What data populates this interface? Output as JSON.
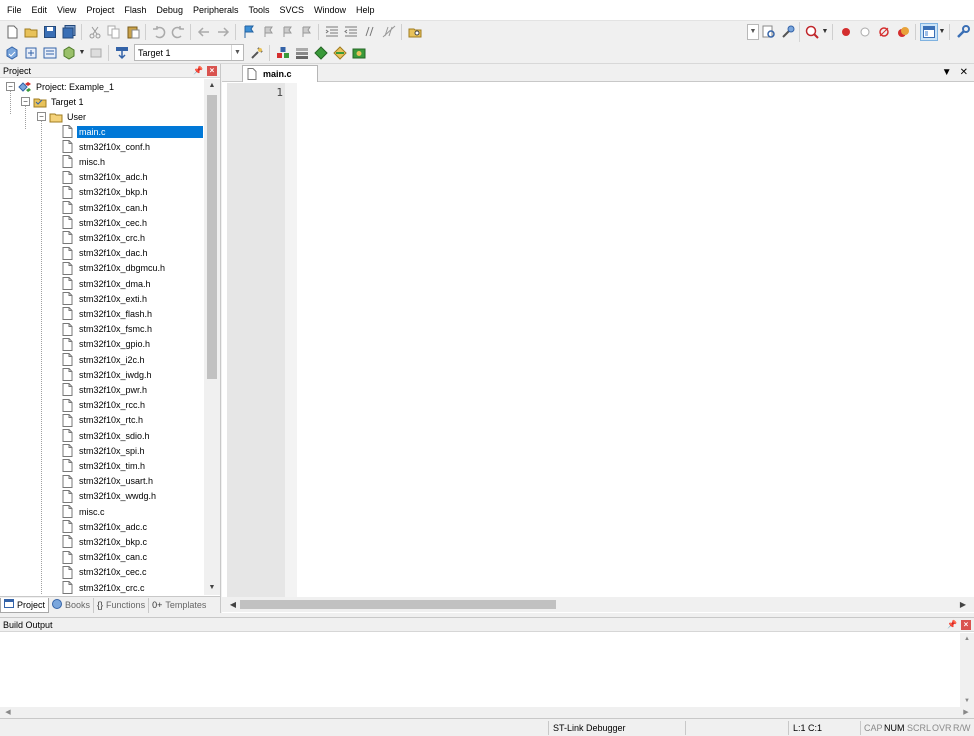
{
  "menu": [
    "File",
    "Edit",
    "View",
    "Project",
    "Flash",
    "Debug",
    "Peripherals",
    "Tools",
    "SVCS",
    "Window",
    "Help"
  ],
  "toolbar2": {
    "target": "Target 1"
  },
  "project_panel": {
    "title": "Project",
    "project": "Project: Example_1",
    "target": "Target 1",
    "group": "User",
    "files": [
      "main.c",
      "stm32f10x_conf.h",
      "misc.h",
      "stm32f10x_adc.h",
      "stm32f10x_bkp.h",
      "stm32f10x_can.h",
      "stm32f10x_cec.h",
      "stm32f10x_crc.h",
      "stm32f10x_dac.h",
      "stm32f10x_dbgmcu.h",
      "stm32f10x_dma.h",
      "stm32f10x_exti.h",
      "stm32f10x_flash.h",
      "stm32f10x_fsmc.h",
      "stm32f10x_gpio.h",
      "stm32f10x_i2c.h",
      "stm32f10x_iwdg.h",
      "stm32f10x_pwr.h",
      "stm32f10x_rcc.h",
      "stm32f10x_rtc.h",
      "stm32f10x_sdio.h",
      "stm32f10x_spi.h",
      "stm32f10x_tim.h",
      "stm32f10x_usart.h",
      "stm32f10x_wwdg.h",
      "misc.c",
      "stm32f10x_adc.c",
      "stm32f10x_bkp.c",
      "stm32f10x_can.c",
      "stm32f10x_cec.c",
      "stm32f10x_crc.c"
    ],
    "selected_file": "main.c",
    "tabs": [
      {
        "label": "Project",
        "icon": "{}"
      },
      {
        "label": "Books",
        "icon": ""
      },
      {
        "label": "Functions",
        "icon": "{}"
      },
      {
        "label": "Templates",
        "icon": "0+"
      }
    ]
  },
  "editor": {
    "tab": "main.c",
    "line_number": "1"
  },
  "build_output": {
    "title": "Build Output"
  },
  "status": {
    "debugger": "ST-Link Debugger",
    "position": "L:1 C:1",
    "cap": "CAP",
    "num": "NUM",
    "scrl": "SCRL",
    "ovr": "OVR",
    "rw": "R/W"
  },
  "colors": {
    "selection": "#0078d7",
    "panel_close": "#d9534f"
  }
}
